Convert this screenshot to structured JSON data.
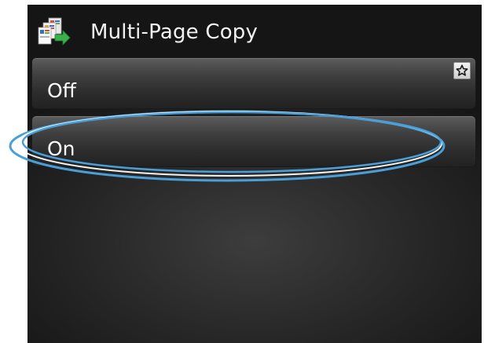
{
  "screen": {
    "title": "Multi-Page Copy",
    "title_icon": "multi-page-copy-icon"
  },
  "options": [
    {
      "label": "Off",
      "selected": false,
      "has_favorite_icon": true
    },
    {
      "label": "On",
      "selected": true,
      "highlighted": true
    }
  ],
  "icons": {
    "favorite": "star-icon"
  },
  "colors": {
    "highlight_ring": "#4a9fd8",
    "icon_green": "#3cb04a",
    "screen_background": "#262626",
    "text": "#ffffff"
  }
}
